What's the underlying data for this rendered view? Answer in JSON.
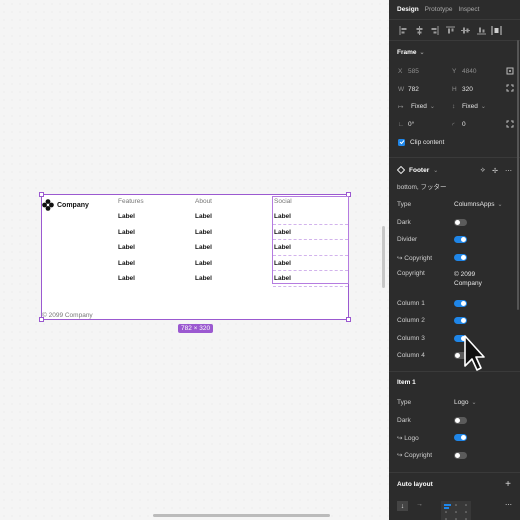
{
  "canvas": {
    "footer_company": "Company",
    "columns": [
      {
        "title": "Features",
        "items": [
          "Label",
          "Label",
          "Label",
          "Label",
          "Label"
        ]
      },
      {
        "title": "About",
        "items": [
          "Label",
          "Label",
          "Label",
          "Label",
          "Label"
        ]
      },
      {
        "title": "Social",
        "items": [
          "Label",
          "Label",
          "Label",
          "Label",
          "Label"
        ]
      }
    ],
    "copyright": "© 2099 Company",
    "size_badge": "782 × 320"
  },
  "panel": {
    "tabs": [
      {
        "label": "Design",
        "active": true
      },
      {
        "label": "Prototype",
        "active": false
      },
      {
        "label": "Inspect",
        "active": false
      }
    ],
    "frame_section": "Frame",
    "x_label": "X",
    "x_value": "585",
    "y_label": "Y",
    "y_value": "4840",
    "w_label": "W",
    "w_value": "782",
    "h_label": "H",
    "h_value": "320",
    "horizontal_constraint": "Fixed",
    "vertical_constraint": "Fixed",
    "rotation": "0°",
    "corner_radius": "0",
    "clip_content": "Clip content",
    "component_name": "Footer",
    "component_subtitle": "bottom, フッター",
    "props": [
      {
        "label": "Type",
        "kind": "select",
        "value": "ColumnsApps"
      },
      {
        "label": "Dark",
        "kind": "toggle",
        "on": false
      },
      {
        "label": "Divider",
        "kind": "toggle",
        "on": true
      },
      {
        "label": "↪ Copyright",
        "kind": "toggle",
        "on": true
      },
      {
        "label": "Copyright",
        "kind": "text",
        "value": "© 2099 Company"
      },
      {
        "label": "Column 1",
        "kind": "toggle",
        "on": true
      },
      {
        "label": "Column 2",
        "kind": "toggle",
        "on": true
      },
      {
        "label": "Column 3",
        "kind": "toggle",
        "on": true
      },
      {
        "label": "Column 4",
        "kind": "toggle",
        "on": false
      }
    ],
    "item_section": "Item 1",
    "item_props": [
      {
        "label": "Type",
        "kind": "select",
        "value": "Logo"
      },
      {
        "label": "Dark",
        "kind": "toggle",
        "on": false
      },
      {
        "label": "↪ Logo",
        "kind": "toggle",
        "on": true
      },
      {
        "label": "↪ Copyright",
        "kind": "toggle",
        "on": false
      }
    ],
    "auto_layout": "Auto layout",
    "auto_layout_gap": "0"
  },
  "colors": {
    "accent": "#1f86e8",
    "selection": "#9b59d0",
    "panel_bg": "#2c2c2c"
  }
}
